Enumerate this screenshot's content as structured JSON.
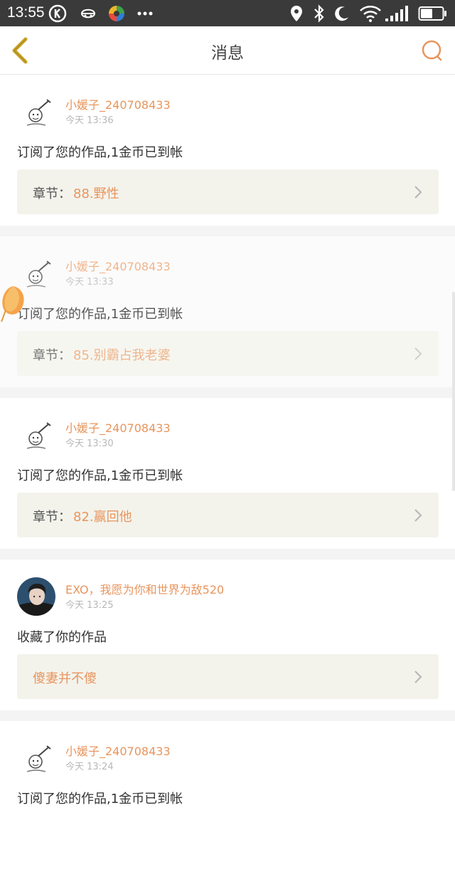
{
  "status_bar": {
    "time": "13:55",
    "icons": [
      "k-badge-icon",
      "mask-icon",
      "app-ball-icon",
      "more-dots-icon",
      "location-icon",
      "bluetooth-icon",
      "moon-icon",
      "wifi-icon",
      "signal-icon",
      "battery-icon"
    ]
  },
  "header": {
    "title": "消息",
    "back_icon": "chevron-left-icon",
    "search_icon": "search-icon"
  },
  "colors": {
    "accent": "#e8955d",
    "back_icon": "#c9a227",
    "work_bg": "#f3f3ec"
  },
  "messages": [
    {
      "user": "小媛子_240708433",
      "time": "今天 13:36",
      "action": "订阅了您的作品,1金币已到帐",
      "work_label": "章节：",
      "work_value": "88.野性"
    },
    {
      "user": "小媛子_240708433",
      "time": "今天 13:33",
      "action": "订阅了您的作品,1金币已到帐",
      "work_label": "章节：",
      "work_value": "85.别霸占我老婆"
    },
    {
      "user": "小媛子_240708433",
      "time": "今天 13:30",
      "action": "订阅了您的作品,1金币已到帐",
      "work_label": "章节：",
      "work_value": "82.赢回他"
    },
    {
      "user": "EXO，我愿为你和世界为敌520",
      "time": "今天 13:25",
      "action": "收藏了你的作品",
      "work_label": "",
      "work_value": "傻妻并不傻"
    },
    {
      "user": "小媛子_240708433",
      "time": "今天 13:24",
      "action": "订阅了您的作品,1金币已到帐"
    }
  ]
}
